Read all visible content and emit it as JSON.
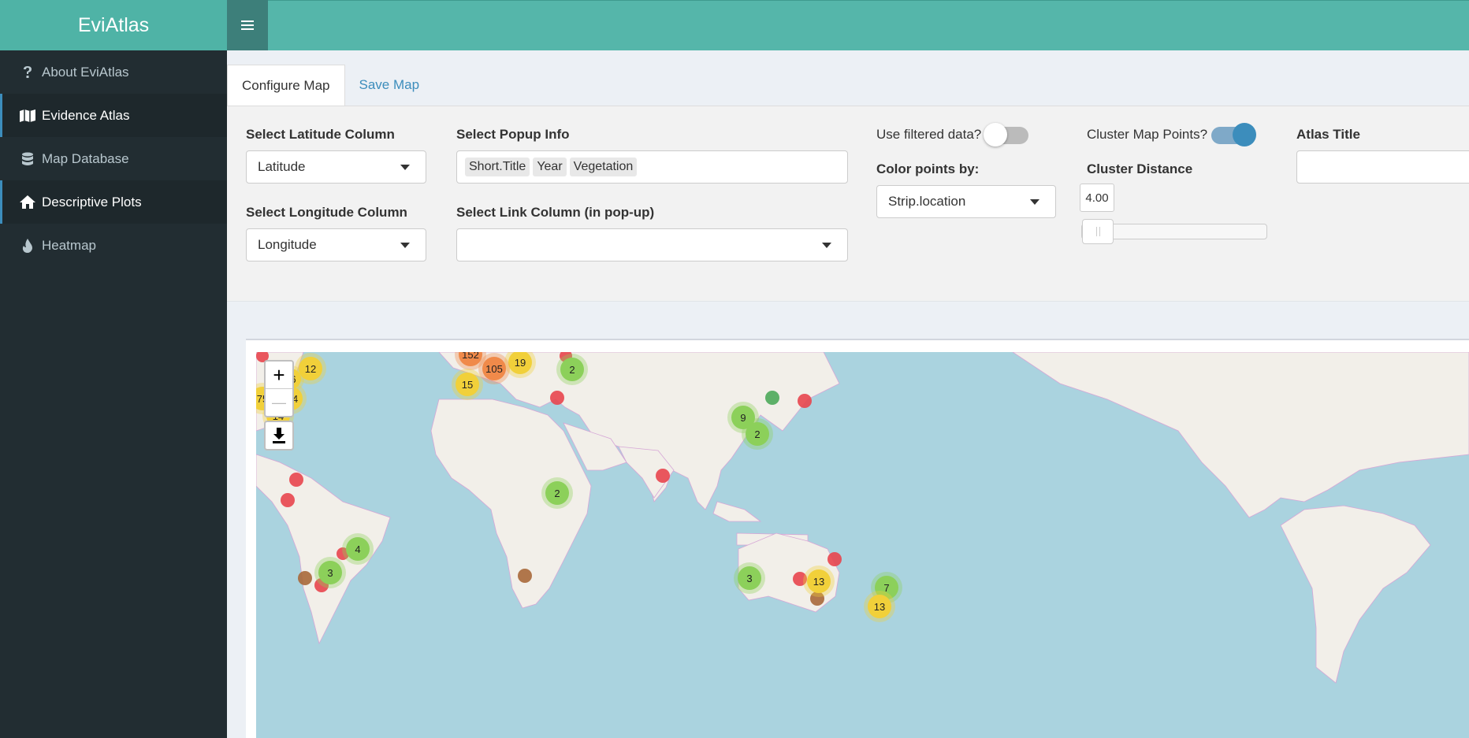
{
  "app": {
    "title": "EviAtlas"
  },
  "sidebar": {
    "items": [
      {
        "label": "About EviAtlas",
        "icon": "question-icon"
      },
      {
        "label": "Evidence Atlas",
        "icon": "map-icon"
      },
      {
        "label": "Map Database",
        "icon": "database-icon"
      },
      {
        "label": "Descriptive Plots",
        "icon": "home-icon"
      },
      {
        "label": "Heatmap",
        "icon": "fire-icon"
      }
    ]
  },
  "tabs": [
    {
      "label": "Configure Map"
    },
    {
      "label": "Save Map"
    }
  ],
  "config": {
    "lat_label": "Select Latitude Column",
    "lat_value": "Latitude",
    "lon_label": "Select Longitude Column",
    "lon_value": "Longitude",
    "popup_label": "Select Popup Info",
    "popup_chips": [
      "Short.Title",
      "Year",
      "Vegetation"
    ],
    "link_label": "Select Link Column (in pop-up)",
    "link_value": "",
    "filtered_label": "Use filtered data?",
    "filtered_on": false,
    "color_label": "Color points by:",
    "color_value": "Strip.location",
    "cluster_label": "Cluster Map Points?",
    "cluster_on": true,
    "distance_label": "Cluster Distance",
    "distance_value": "4.00",
    "distance_fraction": 0.0,
    "atlas_title_label": "Atlas Title",
    "atlas_title_value": ""
  },
  "map": {
    "zoom_in": "+",
    "zoom_out": "—",
    "download_icon": "download-icon",
    "clusters": [
      "152",
      "19",
      "105",
      "2",
      "15",
      "12",
      "6",
      "54",
      "75",
      "14",
      "9",
      "2",
      "2",
      "4",
      "3",
      "3",
      "13",
      "7",
      "13"
    ],
    "colors": {
      "green": "#8cd05a",
      "yellow": "#f1d03a",
      "orange": "#f08a4a",
      "red": "#e8454e",
      "brown": "#a8683a",
      "dark-green": "#4ca85a"
    }
  }
}
